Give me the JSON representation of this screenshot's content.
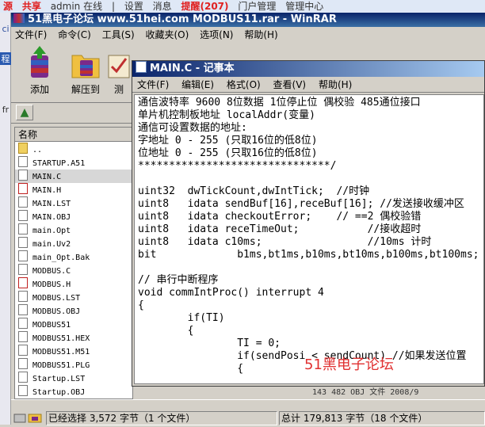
{
  "browser": {
    "items": [
      "源",
      "共享",
      "admin 在线",
      "|",
      "设置",
      "消息",
      "提醒(207)",
      "门户管理",
      "管理中心"
    ]
  },
  "left_edge": {
    "tags": [
      "ci",
      "程",
      "fr"
    ]
  },
  "winrar": {
    "title": "51黑电子论坛 www.51hei.com MODBUS11.rar - WinRAR",
    "menu": [
      "文件(F)",
      "命令(C)",
      "工具(S)",
      "收藏夹(O)",
      "选项(N)",
      "帮助(H)"
    ],
    "toolbar": [
      {
        "label": "添加",
        "icon": "add-archive-icon"
      },
      {
        "label": "解压到",
        "icon": "extract-folder-icon"
      },
      {
        "label": "测",
        "icon": "test-icon"
      }
    ],
    "column_header": "名称",
    "files": [
      {
        "name": "..",
        "type": "folder"
      },
      {
        "name": "STARTUP.A51",
        "type": "file"
      },
      {
        "name": "MAIN.C",
        "type": "file"
      },
      {
        "name": "MAIN.H",
        "type": "hex"
      },
      {
        "name": "MAIN.LST",
        "type": "file"
      },
      {
        "name": "MAIN.OBJ",
        "type": "file"
      },
      {
        "name": "main.Opt",
        "type": "file"
      },
      {
        "name": "main.Uv2",
        "type": "file"
      },
      {
        "name": "main_Opt.Bak",
        "type": "file"
      },
      {
        "name": "MODBUS.C",
        "type": "file"
      },
      {
        "name": "MODBUS.H",
        "type": "hex"
      },
      {
        "name": "MODBUS.LST",
        "type": "file"
      },
      {
        "name": "MODBUS.OBJ",
        "type": "file"
      },
      {
        "name": "MODBUS51",
        "type": "file"
      },
      {
        "name": "MODBUS51.HEX",
        "type": "file"
      },
      {
        "name": "MODBUS51.M51",
        "type": "file"
      },
      {
        "name": "MODBUS51.PLG",
        "type": "file"
      },
      {
        "name": "Startup.LST",
        "type": "file"
      },
      {
        "name": "Startup.OBJ",
        "type": "file"
      }
    ],
    "selected_file": "MAIN.C",
    "behind_row": "143    482  OBJ 文件   2008/9",
    "status_left": "已经选择 3,572 字节（1 个文件）",
    "status_right": "总计 179,813 字节（18 个文件）"
  },
  "notepad": {
    "title": "MAIN.C - 记事本",
    "menu": [
      "文件(F)",
      "编辑(E)",
      "格式(O)",
      "查看(V)",
      "帮助(H)"
    ],
    "lines": [
      "通信波特率 9600 8位数据 1位停止位 偶校验 485通位接口",
      "单片机控制板地址 localAddr(变量)",
      "通信可设置数据的地址:",
      "字地址 0 - 255 (只取16位的低8位)",
      "位地址 0 - 255 (只取16位的低8位)",
      "*******************************/",
      "",
      "uint32  dwTickCount,dwIntTick;  //时钟",
      "uint8   idata sendBuf[16],receBuf[16]; //发送接收缓冲区",
      "uint8   idata checkoutError;    // ==2 偶校验错",
      "uint8   idata receTimeOut;           //接收超时",
      "uint8   idata c10ms;                 //10ms 计时",
      "bit             b1ms,bt1ms,b10ms,bt10ms,b100ms,bt100ms;",
      "",
      "// 串行中断程序",
      "void commIntProc() interrupt 4",
      "{",
      "        if(TI)",
      "        {",
      "                TI = 0;",
      "                if(sendPosi < sendCount) //如果发送位置",
      "                {"
    ],
    "watermark": "51黑电子论坛"
  }
}
